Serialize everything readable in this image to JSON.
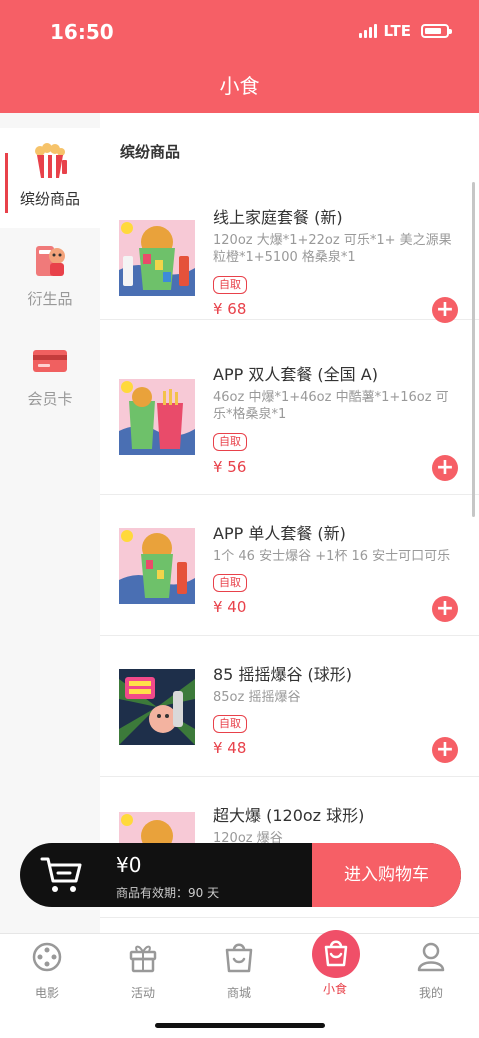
{
  "status": {
    "time": "16:50",
    "network": "LTE"
  },
  "header": {
    "title": "小食"
  },
  "sidebar": {
    "items": [
      {
        "label": "缤纷商品",
        "icon": "popcorn-icon",
        "active": true
      },
      {
        "label": "衍生品",
        "icon": "merch-phone-icon",
        "active": false
      },
      {
        "label": "会员卡",
        "icon": "card-icon",
        "active": false
      }
    ]
  },
  "section": {
    "title": "缤纷商品"
  },
  "products": [
    {
      "name": "线上家庭套餐 (新)",
      "desc": "120oz 大爆*1+22oz 可乐*1+ 美之源果粒橙*1+5100 格桑泉*1",
      "tag": "自取",
      "price": "¥ 68"
    },
    {
      "name": "APP 双人套餐 (全国 A)",
      "desc": "46oz 中爆*1+46oz 中酷薯*1+16oz 可乐*格桑泉*1",
      "tag": "自取",
      "price": "¥ 56"
    },
    {
      "name": "APP 单人套餐 (新)",
      "desc": "1个 46 安士爆谷 +1杯 16 安士可口可乐",
      "tag": "自取",
      "price": "¥ 40"
    },
    {
      "name": "85 摇摇爆谷 (球形)",
      "desc": "85oz 摇摇爆谷",
      "tag": "自取",
      "price": "¥ 48"
    },
    {
      "name": "超大爆 (120oz 球形)",
      "desc": "120oz 爆谷",
      "tag": "",
      "price": ""
    }
  ],
  "cart": {
    "amount": "¥0",
    "validity": "商品有效期：90 天",
    "checkout_label": "进入购物车"
  },
  "tabbar": {
    "items": [
      {
        "label": "电影",
        "icon": "film-reel-icon"
      },
      {
        "label": "活动",
        "icon": "gift-icon"
      },
      {
        "label": "商城",
        "icon": "shopping-bag-icon"
      },
      {
        "label": "小食",
        "icon": "snack-bag-icon",
        "active": true
      },
      {
        "label": "我的",
        "icon": "profile-icon"
      }
    ]
  },
  "colors": {
    "brand": "#f65f66",
    "price": "#e8414a",
    "cart_bg": "#111111"
  }
}
